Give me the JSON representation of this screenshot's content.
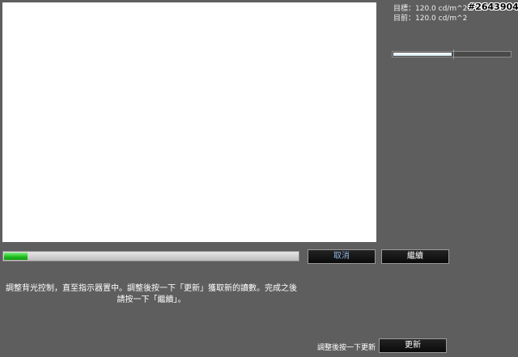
{
  "watermark": "#2643904",
  "readouts": {
    "target": "目標：120.0 cd/m^2",
    "current": "目前：120.0 cd/m^2"
  },
  "level_meter": {
    "fill_fraction": 0.5,
    "target_fraction": 0.52
  },
  "progress": {
    "fraction": 0.08,
    "color": "#1dbb1d"
  },
  "buttons": {
    "cancel_label": "取消",
    "continue_label": "繼續",
    "update_label": "更新"
  },
  "instruction": "調整背光控制，直至指示器置中。調整後按一下「更新」獲取新的讀數。完成之後請按一下「繼續」。",
  "update_hint": "調整後按一下更新"
}
